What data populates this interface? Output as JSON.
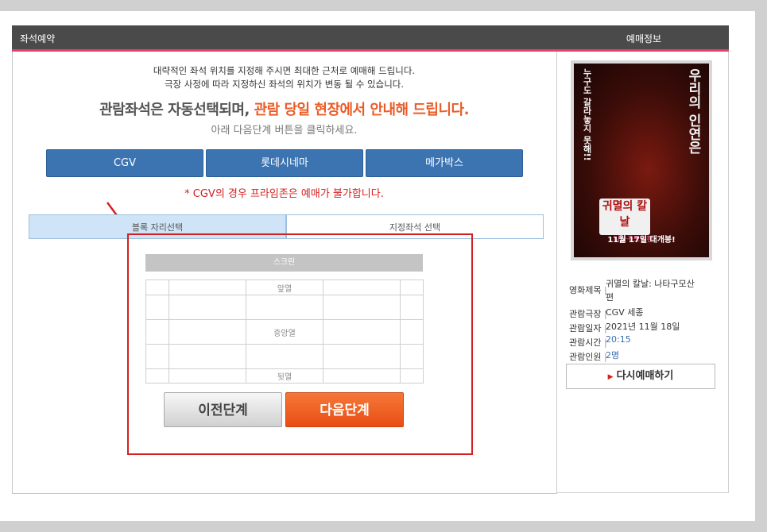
{
  "header": {
    "left_title": "좌석예약",
    "right_title": "예매정보"
  },
  "notice": {
    "line1": "대략적인 좌석 위치를 지정해 주시면 최대한 근처로 예매해 드립니다.",
    "line2": "극장 사정에 따라 지정하신 좌석의 위치가 변동 될 수 있습니다.",
    "headline_plain": "관람좌석은 자동선택되며,",
    "headline_highlight": "관람 당일 현장에서 안내해 드립니다.",
    "instruction": "아래 다음단계 버튼을 클릭하세요."
  },
  "cinemas": [
    "CGV",
    "롯데시네마",
    "메가박스"
  ],
  "warning": "* CGV의 경우 프라임존은 예매가 불가합니다.",
  "seat_tabs": {
    "block": "블록 자리선택",
    "assigned": "지정좌석 선택"
  },
  "seatmap": {
    "screen": "스크린",
    "front": "앞열",
    "middle": "중앙열",
    "back": "뒷열"
  },
  "nav": {
    "prev": "이전단계",
    "next": "다음단계"
  },
  "poster": {
    "vertical_left": "누구도 갈라놓지 못해!!",
    "vertical_right": "우리의 인연은",
    "title": "귀멸의 칼날",
    "subtitle": "나타구모산편",
    "release": "11월 17일 대개봉!"
  },
  "booking_info": {
    "movie_label": "영화제목",
    "movie_line1": "귀멸의 칼날: 나타구모산",
    "movie_line2": "편",
    "theater_label": "관람극장",
    "theater": "CGV 세종",
    "date_label": "관람일자",
    "date": "2021년 11월 18일",
    "time_label": "관람시간",
    "time": "20:15",
    "people_label": "관람인원",
    "people": "2명"
  },
  "rebook": "다시예매하기",
  "colors": {
    "brand_blue": "#3c74b2",
    "accent_orange": "#ea5c27",
    "warning_red": "#d42020",
    "header_dark": "#4a4a4a",
    "header_accent": "#e2436c"
  }
}
